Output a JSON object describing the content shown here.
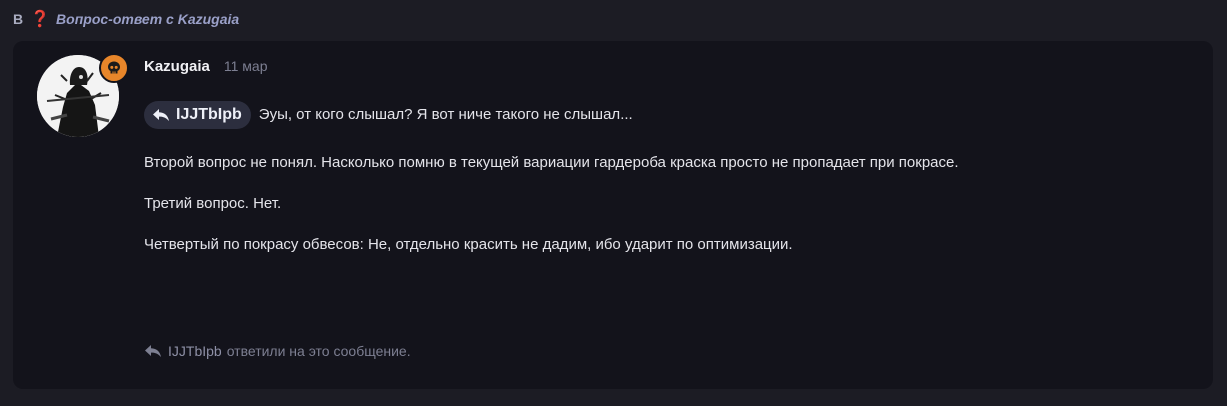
{
  "breadcrumb": {
    "prefix": "В",
    "icon": "question-mark-icon",
    "topic": "Вопрос-ответ с Kazugaia"
  },
  "post": {
    "author": "Kazugaia",
    "date": "11 мар",
    "badge_icon": "skull-icon",
    "accent_color": "#e8862a",
    "reply_to": {
      "name": "IJJTbIpb",
      "icon": "reply-arrow-icon"
    },
    "reply_text": "Эуы, от кого слышал? Я вот ниче такого не слышал...",
    "paragraphs": [
      "Второй вопрос не понял. Насколько помню в текущей вариации гардероба краска просто не пропадает при покрасе.",
      "Третий вопрос. Нет.",
      "Четвертый по покрасу обвесов: Не, отдельно красить не дадим, ибо ударит по оптимизации."
    ]
  },
  "footer": {
    "icon": "reply-arrow-icon",
    "replier": "IJJTbIpb",
    "text": "ответили на это сообщение."
  }
}
